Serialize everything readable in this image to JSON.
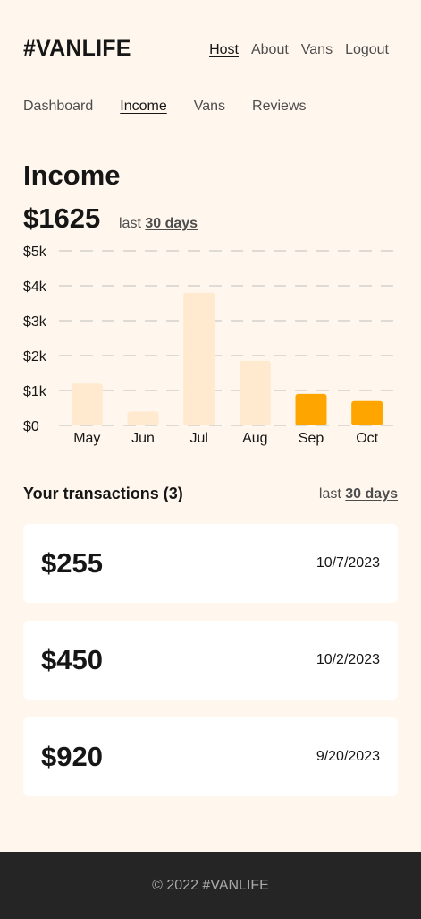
{
  "brand": "#VANLIFE",
  "main_nav": [
    {
      "label": "Host",
      "active": true
    },
    {
      "label": "About",
      "active": false
    },
    {
      "label": "Vans",
      "active": false
    },
    {
      "label": "Logout",
      "active": false
    }
  ],
  "sub_nav": [
    {
      "label": "Dashboard",
      "active": false
    },
    {
      "label": "Income",
      "active": true
    },
    {
      "label": "Vans",
      "active": false
    },
    {
      "label": "Reviews",
      "active": false
    }
  ],
  "income": {
    "title": "Income",
    "amount": "$1625",
    "period_prefix": "last",
    "period_value": "30 days"
  },
  "colors": {
    "background": "#FFF7ED",
    "bar_past": "#FFEAD0",
    "bar_recent": "#FFA500",
    "footer_bg": "#252525"
  },
  "chart_data": {
    "type": "bar",
    "categories": [
      "May",
      "Jun",
      "Jul",
      "Aug",
      "Sep",
      "Oct"
    ],
    "values": [
      1200,
      400,
      3800,
      1850,
      900,
      700
    ],
    "highlighted": [
      false,
      false,
      false,
      false,
      true,
      true
    ],
    "y_ticks": [
      "$0",
      "$1k",
      "$2k",
      "$3k",
      "$4k",
      "$5k"
    ],
    "ylim": [
      0,
      5000
    ],
    "grid": true
  },
  "transactions": {
    "title": "Your transactions (3)",
    "period_prefix": "last",
    "period_value": "30 days",
    "items": [
      {
        "amount": "$255",
        "date": "10/7/2023"
      },
      {
        "amount": "$450",
        "date": "10/2/2023"
      },
      {
        "amount": "$920",
        "date": "9/20/2023"
      }
    ]
  },
  "footer": {
    "text": "© 2022 #VANLIFE"
  }
}
